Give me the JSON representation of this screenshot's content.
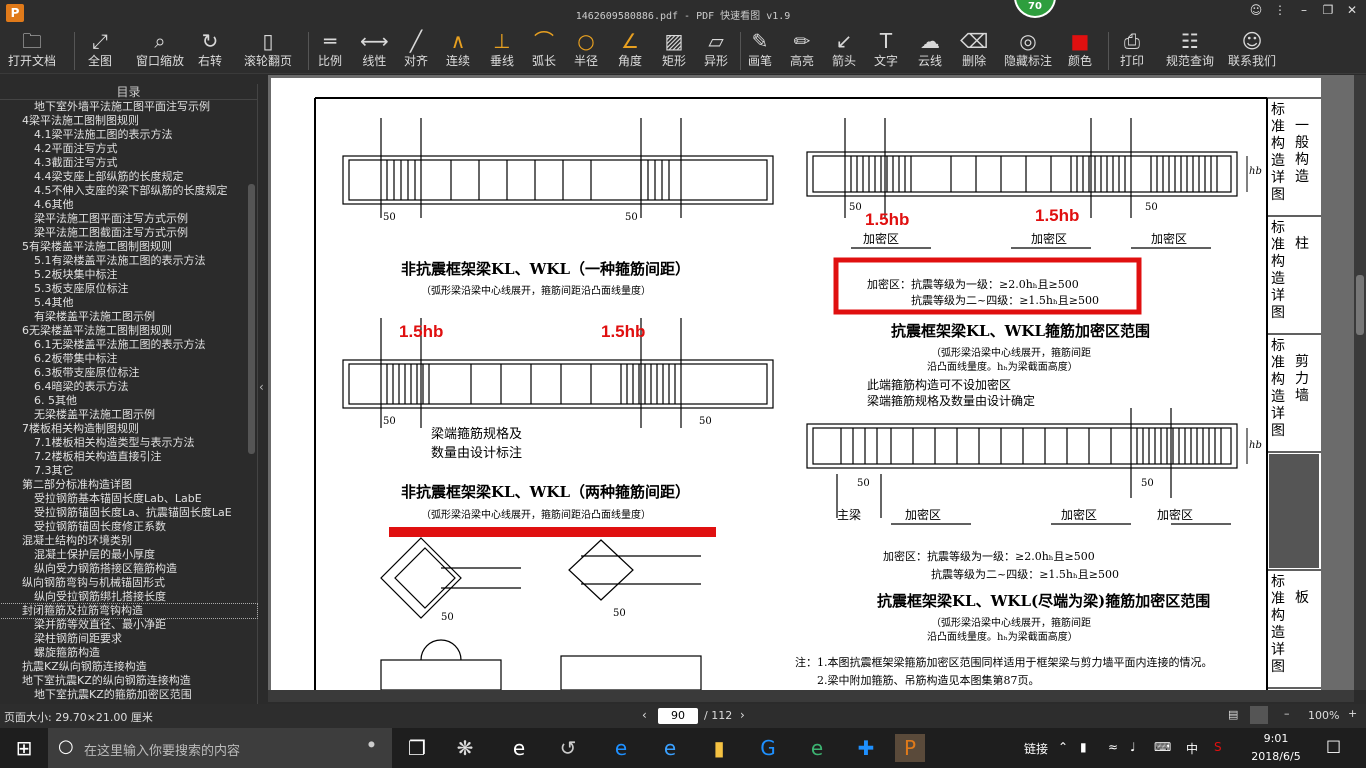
{
  "window": {
    "title": "1462609580886.pdf - PDF 快速看图 v1.9",
    "app_logo": "P",
    "badge": "70"
  },
  "toolbar": {
    "items": [
      {
        "label": "打开文档",
        "icon": "folder-icon"
      },
      {
        "label": "全图",
        "icon": "fit-all-icon"
      },
      {
        "label": "窗口缩放",
        "icon": "zoom-window-icon"
      },
      {
        "label": "右转",
        "icon": "rotate-right-icon"
      },
      {
        "label": "滚轮翻页",
        "icon": "mouse-wheel-icon"
      },
      {
        "label": "比例",
        "icon": "scale-icon"
      },
      {
        "label": "线性",
        "icon": "linear-measure-icon"
      },
      {
        "label": "对齐",
        "icon": "align-measure-icon"
      },
      {
        "label": "连续",
        "icon": "continuous-measure-icon"
      },
      {
        "label": "垂线",
        "icon": "perpendicular-icon"
      },
      {
        "label": "弧长",
        "icon": "arc-length-icon"
      },
      {
        "label": "半径",
        "icon": "radius-icon"
      },
      {
        "label": "角度",
        "icon": "angle-icon"
      },
      {
        "label": "矩形",
        "icon": "rectangle-area-icon"
      },
      {
        "label": "异形",
        "icon": "polygon-area-icon"
      },
      {
        "label": "画笔",
        "icon": "pen-icon"
      },
      {
        "label": "高亮",
        "icon": "highlighter-icon"
      },
      {
        "label": "箭头",
        "icon": "arrow-icon"
      },
      {
        "label": "文字",
        "icon": "text-icon"
      },
      {
        "label": "云线",
        "icon": "cloud-line-icon"
      },
      {
        "label": "删除",
        "icon": "eraser-icon"
      },
      {
        "label": "隐藏标注",
        "icon": "hide-annotation-icon"
      },
      {
        "label": "颜色",
        "icon": "color-swatch-icon"
      },
      {
        "label": "打印",
        "icon": "printer-icon"
      },
      {
        "label": "规范查询",
        "icon": "book-search-icon"
      },
      {
        "label": "联系我们",
        "icon": "contact-icon"
      }
    ],
    "color_swatch": "#e01010"
  },
  "sidebar": {
    "header": "目录",
    "items": [
      {
        "t": "地下室外墙平法施工图平面注写示例",
        "d": 2
      },
      {
        "t": "4梁平法施工图制图规则",
        "d": 1
      },
      {
        "t": "4.1梁平法施工图的表示方法",
        "d": 2
      },
      {
        "t": "4.2平面注写方式",
        "d": 2
      },
      {
        "t": "4.3截面注写方式",
        "d": 2
      },
      {
        "t": "4.4梁支座上部纵筋的长度规定",
        "d": 2
      },
      {
        "t": "4.5不伸入支座的梁下部纵筋的长度规定",
        "d": 2
      },
      {
        "t": "4.6其他",
        "d": 2
      },
      {
        "t": "梁平法施工图平面注写方式示例",
        "d": 2
      },
      {
        "t": "梁平法施工图截面注写方式示例",
        "d": 2
      },
      {
        "t": "5有梁楼盖平法施工图制图规则",
        "d": 1
      },
      {
        "t": "5.1有梁楼盖平法施工图的表示方法",
        "d": 2
      },
      {
        "t": "5.2板块集中标注",
        "d": 2
      },
      {
        "t": "5.3板支座原位标注",
        "d": 2
      },
      {
        "t": "5.4其他",
        "d": 2
      },
      {
        "t": "有梁楼盖平法施工图示例",
        "d": 2
      },
      {
        "t": "6无梁楼盖平法施工图制图规则",
        "d": 1
      },
      {
        "t": "6.1无梁楼盖平法施工图的表示方法",
        "d": 2
      },
      {
        "t": "6.2板带集中标注",
        "d": 2
      },
      {
        "t": "6.3板带支座原位标注",
        "d": 2
      },
      {
        "t": "6.4暗梁的表示方法",
        "d": 2
      },
      {
        "t": "6. 5其他",
        "d": 2
      },
      {
        "t": "无梁楼盖平法施工图示例",
        "d": 2
      },
      {
        "t": "7楼板相关构造制图规则",
        "d": 1
      },
      {
        "t": "7.1楼板相关构造类型与表示方法",
        "d": 2
      },
      {
        "t": "7.2楼板相关构造直接引注",
        "d": 2
      },
      {
        "t": "7.3其它",
        "d": 2
      },
      {
        "t": "第二部分标准构造详图",
        "d": 1
      },
      {
        "t": "受拉钢筋基本锚固长度Lab、LabE",
        "d": 2
      },
      {
        "t": "受拉钢筋锚固长度La、抗震锚固长度LaE",
        "d": 2
      },
      {
        "t": "受拉钢筋锚固长度修正系数",
        "d": 2
      },
      {
        "t": "混凝土结构的环境类别",
        "d": 1
      },
      {
        "t": "混凝土保护层的最小厚度",
        "d": 2
      },
      {
        "t": "纵向受力钢筋搭接区箍筋构造",
        "d": 2
      },
      {
        "t": "纵向钢筋弯钩与机械锚固形式",
        "d": 1
      },
      {
        "t": "纵向受拉钢筋绑扎搭接长度",
        "d": 2
      },
      {
        "t": "封闭箍筋及拉筋弯钩构造",
        "d": 1,
        "sel": true
      },
      {
        "t": "梁并筋等效直径、最小净距",
        "d": 2
      },
      {
        "t": "梁柱钢筋间距要求",
        "d": 2
      },
      {
        "t": "螺旋箍筋构造",
        "d": 2
      },
      {
        "t": "抗震KZ纵向钢筋连接构造",
        "d": 1
      },
      {
        "t": "地下室抗震KZ的纵向钢筋连接构造",
        "d": 1
      },
      {
        "t": "地下室抗震KZ的箍筋加密区范围",
        "d": 2
      }
    ]
  },
  "page": {
    "title1": "非抗震框架梁KL、WKL（一种箍筋间距）",
    "sub1": "（弧形梁沿梁中心线展开，箍筋间距沿凸面线量度）",
    "title2": "非抗震框架梁KL、WKL（两种箍筋间距）",
    "sub2": "（弧形梁沿梁中心线展开，箍筋间距沿凸面线量度）",
    "note2a": "梁端箍筋规格及",
    "note2b": "数量由设计标注",
    "title3": "抗震框架梁KL、WKL箍筋加密区范围",
    "sub3a": "（弧形梁沿梁中心线展开，箍筋间距",
    "sub3b": "沿凸面线量度。hₕ为梁截面高度）",
    "box_line1": "加密区：抗震等级为一级：≥2.0hₕ且≥500",
    "box_line2": "抗震等级为二~四级：≥1.5hₕ且≥500",
    "zone": "加密区",
    "hb": "hb",
    "dim50": "50",
    "redlabel": "1.5hb",
    "note4a": "此端箍筋构造可不设加密区",
    "note4b": "梁端箍筋规格及数量由设计确定",
    "main_beam": "主梁",
    "req4a": "加密区：抗震等级为一级：≥2.0hₕ且≥500",
    "req4b": "抗震等级为二~四级：≥1.5hₕ且≥500",
    "title4": "抗震框架梁KL、WKL(尽端为梁)箍筋加密区范围",
    "sub4a": "（弧形梁沿梁中心线展开，箍筋间距",
    "sub4b": "沿凸面线量度。hₕ为梁截面高度）",
    "footnote1": "注：1.本图抗震框架梁箍筋加密区范围同样适用于框架梁与剪力墙平面内连接的情况。",
    "footnote2": "2.梁中附加箍筋、吊筋构造见本图集第87页。",
    "side_tabs": [
      {
        "a": "标准构造详图",
        "b": "一般构造"
      },
      {
        "a": "标准构造详图",
        "b": "柱"
      },
      {
        "a": "标准构造详图",
        "b": "剪力墙"
      },
      {
        "a": "",
        "b": ""
      },
      {
        "a": "标准构造详图",
        "b": "板"
      }
    ]
  },
  "status": {
    "page_size": "页面大小: 29.70×21.00 厘米",
    "page_current": "90",
    "page_total": "/ 112",
    "zoom": "100%"
  },
  "taskbar": {
    "search_placeholder": "在这里输入你要搜索的内容",
    "link": "链接",
    "ime": "中",
    "time": "9:01",
    "date": "2018/6/5"
  }
}
